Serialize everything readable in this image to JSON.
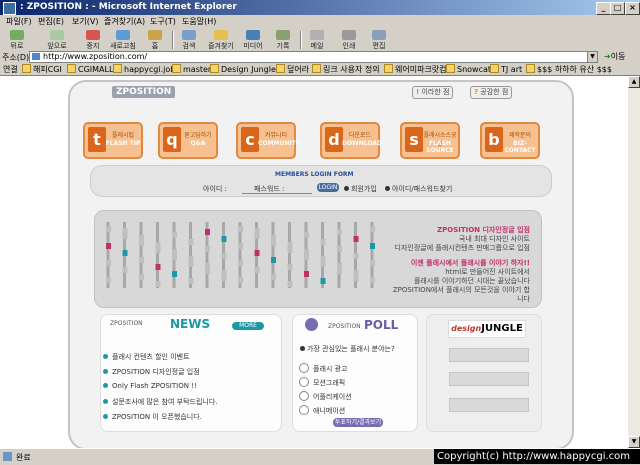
{
  "window": {
    "title": ": ZPOSITION : - Microsoft Internet Explorer"
  },
  "menu": [
    "파일(F)",
    "편집(E)",
    "보기(V)",
    "즐겨찾기(A)",
    "도구(T)",
    "도움말(H)"
  ],
  "toolbar": [
    "뒤로",
    "앞으로",
    "중지",
    "새로고침",
    "홈",
    "검색",
    "즐겨찾기",
    "미디어",
    "기록",
    "메일",
    "인쇄",
    "편집"
  ],
  "address": {
    "label": "주소(D)",
    "url": "http://www.zposition.com/",
    "go": "이동"
  },
  "links": {
    "label": "연결",
    "items": [
      "해피CGI",
      "CGIMALL",
      "happycgi.job",
      "master",
      "Design Jungle",
      "덮어라",
      "링크 사용자 정의",
      "웨어미파크랏컴",
      "Snowcat",
      "TJ art",
      "$$$ 하하하 유산 $$$"
    ]
  },
  "status": {
    "text": "완료"
  },
  "copyright": "Copyright(c) http://www.happycgi.com",
  "site": {
    "logo": "ZPOSITION",
    "top_buttons": [
      "이라한 점",
      "공감한 점"
    ],
    "nav": [
      {
        "icon": "t",
        "kr": "플래시팁",
        "en": "FLASH TIP"
      },
      {
        "icon": "q",
        "kr": "묻고답하기",
        "en": "Q&A"
      },
      {
        "icon": "c",
        "kr": "커뮤니티",
        "en": "COMMUNITY"
      },
      {
        "icon": "d",
        "kr": "다운로드",
        "en": "DOWNLOAD"
      },
      {
        "icon": "s",
        "kr": "플래시소스공유",
        "en": "FLASH SOURCE"
      },
      {
        "icon": "b",
        "kr": "제작문의",
        "en": "BIZ-CONTACT"
      }
    ],
    "login": {
      "title": "MEMBERS LOGIN FORM",
      "id_label": "아이디 :",
      "pw_label": "패스워드 :",
      "button": "LOGIN",
      "join": "회원가입",
      "find": "아이디/패스워드찾기"
    },
    "banner": {
      "title1": "ZPOSITION 디자인정글 입점",
      "line1": "국내 최대 디자인 사이트",
      "line2": "디자인정글에 플래시컨텐츠 판매그룹으로 입점",
      "title2": "이젠 플래시에서 플래시를 이야기 하자!!",
      "line3": "html로 만들어진 사이트에서",
      "line4": "플래시를 이야기하던 시대는 끝났습니다",
      "line5": "ZPOSITION에서 플래시의 모든것을 이야기 합니다"
    },
    "news": {
      "sub": "ZPOSITION",
      "title": "NEWS",
      "more": "MORE",
      "items": [
        "플래시 컨텐츠 할인 이벤트",
        "ZPOSITION 디자인정글 입점",
        "Only Flash ZPOSITION !!",
        "설문조사에 많은 참여 부탁드립니다.",
        "ZPOSITION 이 오픈했습니다."
      ]
    },
    "poll": {
      "sub": "ZPOSITION",
      "title": "POLL",
      "question": "가장 관심있는 플래시 분야는?",
      "options": [
        "플래시 광고",
        "모션그래픽",
        "어플리케이션",
        "애니메이션"
      ],
      "button": "투표하기/결과보기"
    },
    "side": {
      "logo_a": "design",
      "logo_b": "JUNGLE"
    },
    "colors": {
      "accent_orange": "#e08a40",
      "news_teal": "#1b9aa6",
      "poll_purple": "#7a6cb0",
      "banner_pink": "#c2306c"
    }
  }
}
